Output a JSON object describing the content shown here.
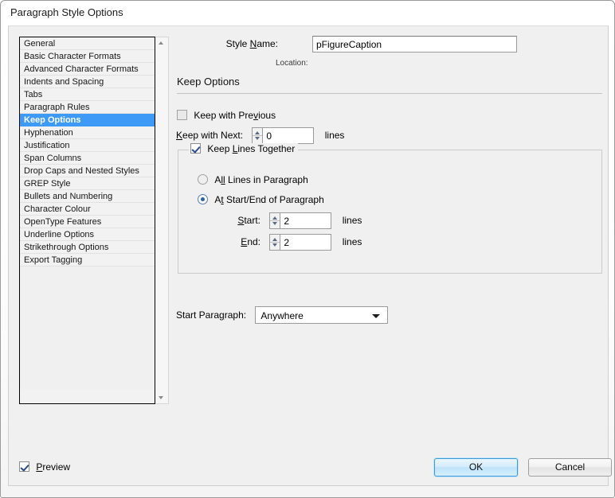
{
  "window": {
    "title": "Paragraph Style Options"
  },
  "sidebar": {
    "items": [
      {
        "label": "General",
        "selected": false
      },
      {
        "label": "Basic Character Formats",
        "selected": false
      },
      {
        "label": "Advanced Character Formats",
        "selected": false
      },
      {
        "label": "Indents and Spacing",
        "selected": false
      },
      {
        "label": "Tabs",
        "selected": false
      },
      {
        "label": "Paragraph Rules",
        "selected": false
      },
      {
        "label": "Keep Options",
        "selected": true
      },
      {
        "label": "Hyphenation",
        "selected": false
      },
      {
        "label": "Justification",
        "selected": false
      },
      {
        "label": "Span Columns",
        "selected": false
      },
      {
        "label": "Drop Caps and Nested Styles",
        "selected": false
      },
      {
        "label": "GREP Style",
        "selected": false
      },
      {
        "label": "Bullets and Numbering",
        "selected": false
      },
      {
        "label": "Character Colour",
        "selected": false
      },
      {
        "label": "OpenType Features",
        "selected": false
      },
      {
        "label": "Underline Options",
        "selected": false
      },
      {
        "label": "Strikethrough Options",
        "selected": false
      },
      {
        "label": "Export Tagging",
        "selected": false
      }
    ],
    "scrollbar": {
      "up_icon": "scroll-up-arrow-icon",
      "down_icon": "scroll-down-arrow-icon"
    }
  },
  "style_name": {
    "label_prefix": "Style ",
    "label_accel": "N",
    "label_suffix": "ame:",
    "value": "pFigureCaption",
    "placeholder": ""
  },
  "location": {
    "label": "Location:",
    "value": ""
  },
  "section": {
    "title": "Keep Options"
  },
  "keep_with_previous": {
    "label_prefix": "Keep with Pre",
    "label_accel": "v",
    "label_suffix": "ious",
    "checked": false
  },
  "keep_with_next": {
    "label_accel": "K",
    "label_suffix": "eep with Next:",
    "value": "0",
    "unit": "lines"
  },
  "keep_lines_together": {
    "label_prefix": "Keep ",
    "label_accel": "L",
    "label_suffix": "ines Together",
    "checked": true,
    "options": [
      {
        "label_prefix": "A",
        "label_accel": "ll",
        "label_suffix": " Lines in Paragraph",
        "selected": false
      },
      {
        "label_prefix": "A",
        "label_accel": "t",
        "label_suffix": " Start/End of Paragraph",
        "selected": true
      }
    ],
    "start": {
      "label_accel": "S",
      "label_suffix": "tart:",
      "value": "2",
      "unit": "lines"
    },
    "end": {
      "label_accel": "E",
      "label_suffix": "nd:",
      "value": "2",
      "unit": "lines"
    }
  },
  "start_paragraph": {
    "label_prefix": "Start Para",
    "label_accel": "g",
    "label_suffix": "raph:",
    "value": "Anywhere",
    "arrow_icon": "chevron-down-icon"
  },
  "preview": {
    "label_accel": "P",
    "label_suffix": "review",
    "checked": true
  },
  "buttons": {
    "ok": "OK",
    "cancel": "Cancel"
  },
  "colors": {
    "selection_blue": "#3d9bf7",
    "dialog_bg": "#f0f0f0",
    "ok_border": "#3c9adc"
  }
}
